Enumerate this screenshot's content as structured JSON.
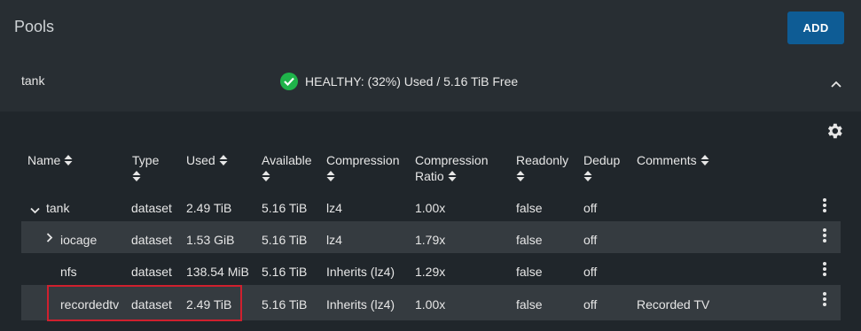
{
  "header": {
    "title": "Pools",
    "add_label": "ADD"
  },
  "pool": {
    "name": "tank",
    "status": "HEALTHY: (32%) Used / 5.16 TiB Free",
    "status_color": "#1fb34a"
  },
  "table": {
    "columns": {
      "name": "Name",
      "type": "Type",
      "used": "Used",
      "available": "Available",
      "compression": "Compression",
      "ratio_line1": "Compression",
      "ratio_line2": "Ratio",
      "readonly": "Readonly",
      "dedup": "Dedup",
      "comments": "Comments"
    },
    "rows": [
      {
        "name": "tank",
        "type": "dataset",
        "used": "2.49 TiB",
        "available": "5.16 TiB",
        "compression": "lz4",
        "ratio": "1.00x",
        "readonly": "false",
        "dedup": "off",
        "comments": ""
      },
      {
        "name": "iocage",
        "type": "dataset",
        "used": "1.53 GiB",
        "available": "5.16 TiB",
        "compression": "lz4",
        "ratio": "1.79x",
        "readonly": "false",
        "dedup": "off",
        "comments": ""
      },
      {
        "name": "nfs",
        "type": "dataset",
        "used": "138.54 MiB",
        "available": "5.16 TiB",
        "compression": "Inherits (lz4)",
        "ratio": "1.29x",
        "readonly": "false",
        "dedup": "off",
        "comments": ""
      },
      {
        "name": "recordedtv",
        "type": "dataset",
        "used": "2.49 TiB",
        "available": "5.16 TiB",
        "compression": "Inherits (lz4)",
        "ratio": "1.00x",
        "readonly": "false",
        "dedup": "off",
        "comments": "Recorded TV"
      }
    ]
  },
  "colors": {
    "accent": "#0e5c95",
    "highlight": "#d0202e"
  }
}
